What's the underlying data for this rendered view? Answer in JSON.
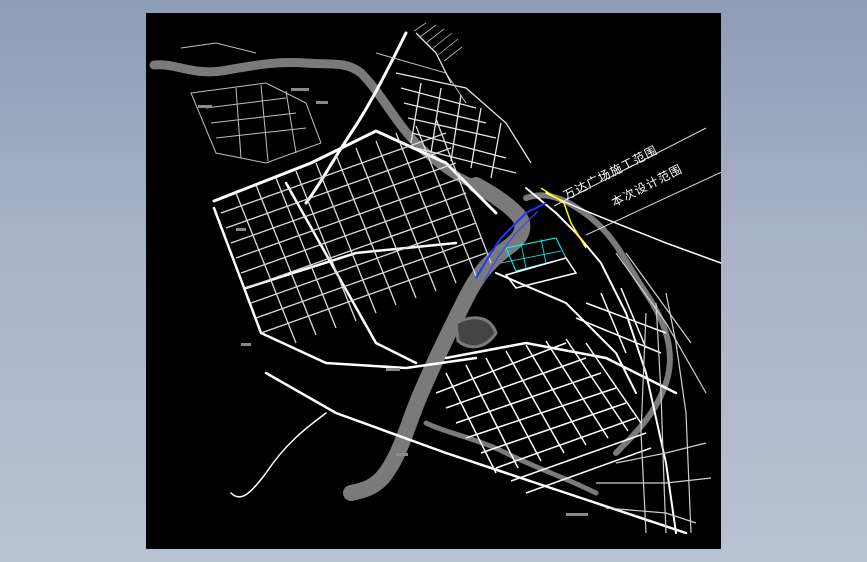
{
  "drawing": {
    "annotations": {
      "construction_scope": "万达广场施工范围",
      "design_scope": "本次设计范围"
    },
    "colors": {
      "background": "#000000",
      "viewport_surround": "#a3aec3",
      "roads": "#ffffff",
      "river": "#7a7a7a",
      "highlight_primary": "#2233ff",
      "highlight_secondary": "#ffff00",
      "highlight_tertiary": "#00ffff"
    }
  }
}
